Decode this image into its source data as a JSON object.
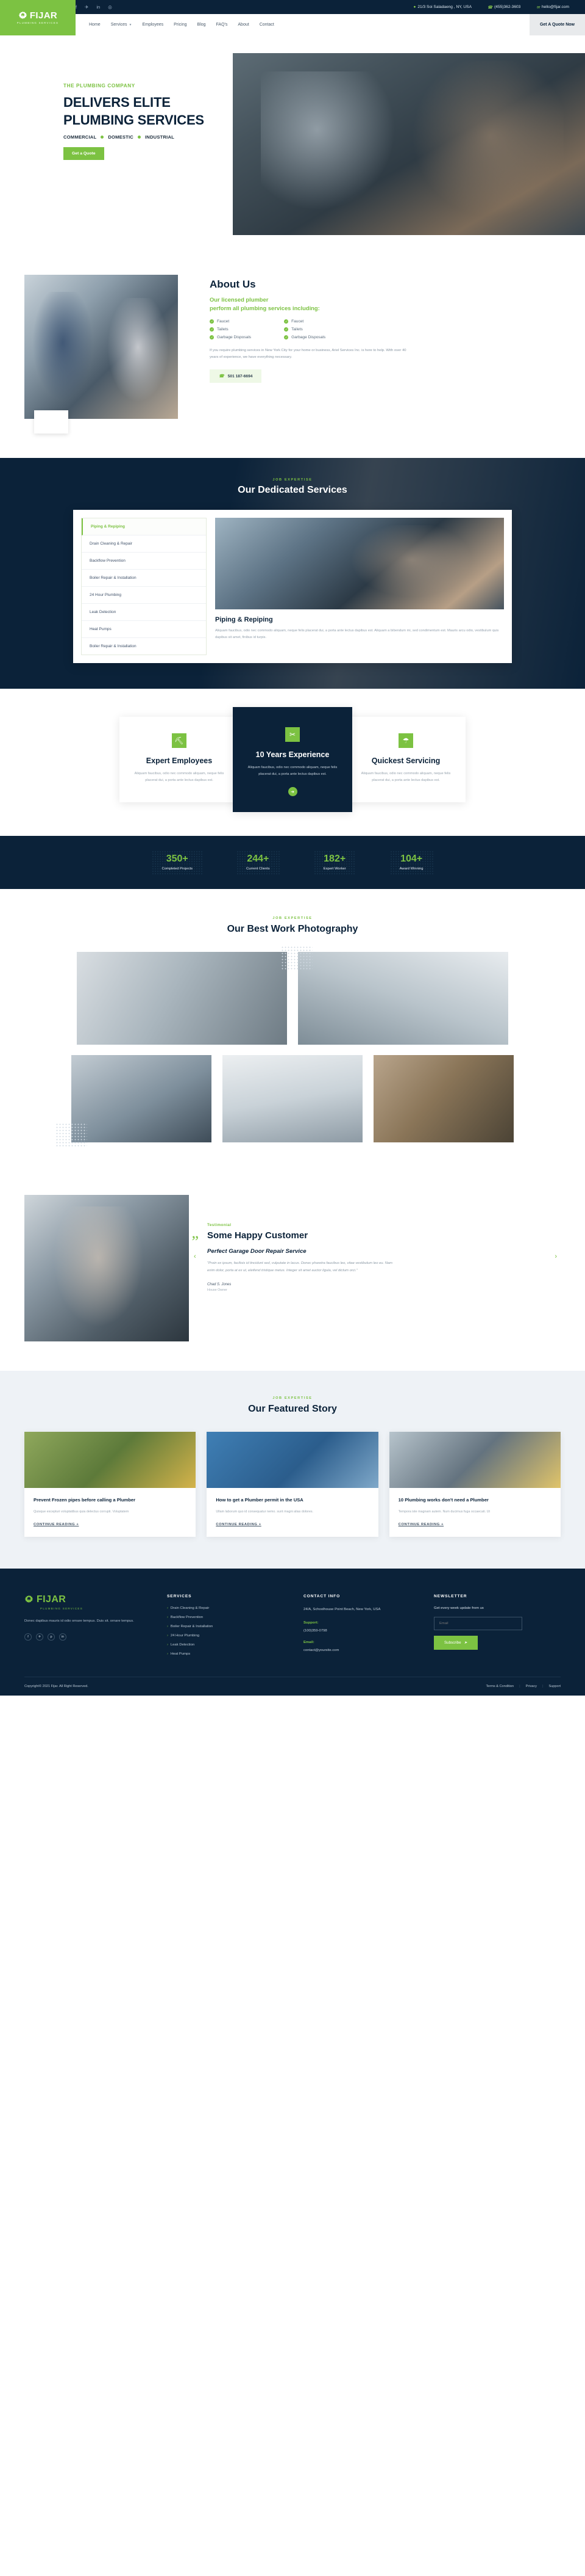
{
  "brand": {
    "name": "FIJAR",
    "tagline": "PLUMBING SERVICES"
  },
  "topbar": {
    "social": [
      {
        "name": "facebook-icon",
        "glyph": "f"
      },
      {
        "name": "twitter-icon",
        "glyph": "✈"
      },
      {
        "name": "linkedin-icon",
        "glyph": "in"
      },
      {
        "name": "instagram-icon",
        "glyph": "◎"
      }
    ],
    "address": "21/3 Soi Saladaeng , NY, USA",
    "phone": "(455)362-3603",
    "email": "hello@fijar.com"
  },
  "nav": {
    "items": [
      {
        "label": "Home",
        "caret": false
      },
      {
        "label": "Services",
        "caret": true
      },
      {
        "label": "Employees",
        "caret": false
      },
      {
        "label": "Pricing",
        "caret": false
      },
      {
        "label": "Blog",
        "caret": false
      },
      {
        "label": "FAQ's",
        "caret": false
      },
      {
        "label": "About",
        "caret": false
      },
      {
        "label": "Contact",
        "caret": false
      }
    ],
    "cta": "Get A Quote Now"
  },
  "hero": {
    "eyebrow": "THE PLUMBING COMPANY",
    "title_line1": "DELIVERS ELITE",
    "title_line2": "PLUMBING SERVICES",
    "tags": [
      "COMMERCIAL",
      "DOMESTIC",
      "INDUSTRIAL"
    ],
    "cta": "Get a Quote"
  },
  "about": {
    "heading": "About Us",
    "subheading": "Our licensed plumber\nperform all plumbing services including:",
    "features_left": [
      "Faucet",
      "Tailets",
      "Garbage Disposals"
    ],
    "features_right": [
      "Faucet",
      "Tailets",
      "Garbage Disposals"
    ],
    "body": "If you require plumbing services in New York City for your home or business, Ariel Services Inc. is here to help. With over 40 years of experience, we have everything necessary.",
    "phone": "501 187-6694"
  },
  "services": {
    "eyebrow": "JOB EXPERTISE",
    "title": "Our Dedicated Services",
    "tabs": [
      "Piping & Repiping",
      "Drain Cleaning & Repair",
      "Backflow Prevention",
      "Boiler Repair & Installation",
      "24 Hour Plumbing",
      "Leak Detection",
      "Heat Pumps",
      "Boiler Repair & Installation"
    ],
    "active_tab": "Piping & Repiping",
    "detail_title": "Piping & Repiping",
    "detail_body": "Aliquam faucibus, odio nec commodo aliquam, neque felis placerat dui, a porta ante lectus dapibus est. Aliquam a bibendum mi, sed condimentum est. Mauris arcu odio, vestibulum quis dapibus sit amet, finibus id turpis."
  },
  "cards3": [
    {
      "icon": "worker-icon",
      "glyph": "⛏",
      "title": "Expert Employees",
      "text": "Aliquam faucibus, odio nec commodo aliquam, neque felis placerat dui, a porta ante lectus dapibus est."
    },
    {
      "icon": "tools-icon",
      "glyph": "✂",
      "title": "10 Years Experience",
      "text": "Aliquam faucibus, odio nec commodo aliquam, neque felis placerat dui, a porta ante lectus dapibus est.",
      "arrow": "➜"
    },
    {
      "icon": "water-drop-icon",
      "glyph": "☂",
      "title": "Quickest Servicing",
      "text": "Aliquam faucibus, odio nec commodo aliquam, neque felis placerat dui, a porta ante lectus dapibus est."
    }
  ],
  "stats": [
    {
      "num": "350+",
      "label": "Completed Projects"
    },
    {
      "num": "244+",
      "label": "Current Clients"
    },
    {
      "num": "182+",
      "label": "Expert Worker"
    },
    {
      "num": "104+",
      "label": "Award Winning"
    }
  ],
  "gallery": {
    "eyebrow": "JOB EXPERTISE",
    "title": "Our Best Work Photography"
  },
  "testimonial": {
    "eyebrow": "Testimonial",
    "heading": "Some Happy Customer",
    "subheading": "Perfect Garage Door Repair Service",
    "quote": "\"Proin ex ipsum, facilisis id tincidunt sed, vulputate in lacus. Donec pharetra faucibus leo, vitae vestibulum leo eu. Nam enim dolor, porta at ex ut, eleifend tristique metus. Integer sit amet auctor ligula, vel dictum orci.\"",
    "author": "Chad S. Jones",
    "role": "House Owner",
    "prev": "‹",
    "next": "›"
  },
  "blog": {
    "eyebrow": "JOB EXPERTISE",
    "title": "Our Featured Story",
    "posts": [
      {
        "title": "Prevent Frozen pipes before calling a Plumber",
        "text": "Quisque excepturi voluptatibus quia delectus corrupti. Voluptatem",
        "read_more": "CONTINUE READING +"
      },
      {
        "title": "How to get a Plumber permit in the USA",
        "text": "Ullam laborum quo id consequatur nemo. sunt magni alias dolores.",
        "read_more": "CONTINUE READING +"
      },
      {
        "title": "10 Plumbing works don't need a Plumber",
        "text": "Tempora iste magnam autem. Num ducimus fuga occaecati. Ut",
        "read_more": "CONTINUE READING +"
      }
    ]
  },
  "footer": {
    "description": "Donec dapibus mauris id odio ornare tempus. Duis sit. ornare tempus.",
    "social": [
      {
        "name": "facebook-icon",
        "glyph": "f"
      },
      {
        "name": "twitter-icon",
        "glyph": "✈"
      },
      {
        "name": "pinterest-icon",
        "glyph": "p"
      },
      {
        "name": "linkedin-icon",
        "glyph": "in"
      }
    ],
    "services_heading": "SERVICES",
    "services": [
      "Drain Cleaning & Repair",
      "Backflow Prevention",
      "Boiler Repair & Installation",
      "24 Hour Plumbing",
      "Leak Detection",
      "Heat Pumps"
    ],
    "contact_heading": "CONTACT INFO",
    "address": "24/A, Schoolhouse Point Beach, New York, USA",
    "support_label": "Support:",
    "support_phone": "(100)359-0798",
    "email_label": "Email:",
    "email": "contact@yoursite.com",
    "newsletter_heading": "NEWSLETTER",
    "newsletter_text": "Get every week update from us",
    "email_placeholder": "Email",
    "subscribe": "Subscribe",
    "subscribe_glyph": "➤",
    "copyright": "Copyright© 2021 Fijar. All Right Reserved.",
    "links": [
      "Terms & Condition",
      "Privacy",
      "Support"
    ]
  },
  "colors": {
    "green": "#7cc242",
    "navy": "#0b2239",
    "light": "#eef2f6"
  }
}
